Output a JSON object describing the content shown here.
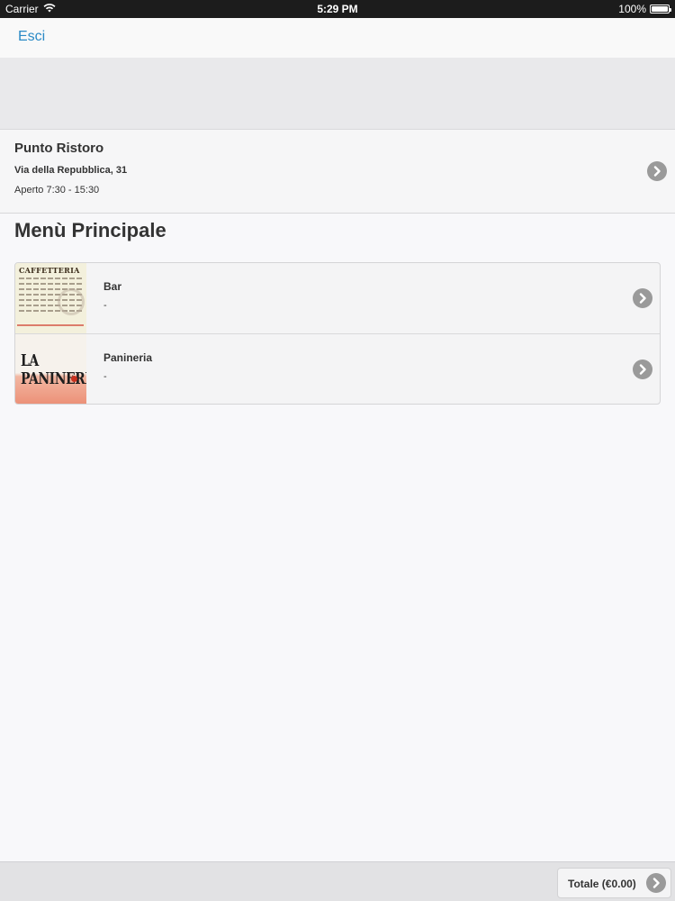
{
  "status_bar": {
    "carrier": "Carrier",
    "time": "5:29 PM",
    "battery": "100%"
  },
  "nav": {
    "back_label": "Esci"
  },
  "venue": {
    "name": "Punto Ristoro",
    "address": "Via della Repubblica, 31",
    "hours": "Aperto 7:30 - 15:30"
  },
  "section": {
    "title": "Menù Principale"
  },
  "menus": [
    {
      "title": "Bar",
      "subtitle": "-",
      "thumb_text": "CAFFETTERIA"
    },
    {
      "title": "Panineria",
      "subtitle": "-",
      "thumb_text": "LA PANINERIA"
    }
  ],
  "footer": {
    "total_label": "Totale (€0.00)"
  },
  "icons": {
    "chevron": "chevron-right-icon",
    "wifi": "wifi-icon",
    "battery": "battery-icon"
  },
  "colors": {
    "accent": "#2b8ac6",
    "chevron_bg": "#9a9a9a",
    "status_bar_bg": "#1c1c1c"
  }
}
